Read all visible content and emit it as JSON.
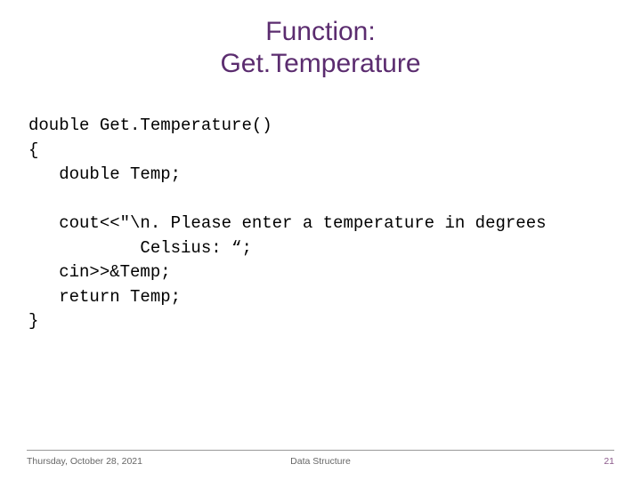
{
  "title_line1": "Function:",
  "title_line2": "Get.Temperature",
  "code": "double Get.Temperature()\n{\n   double Temp;\n\n   cout<<\"\\n. Please enter a temperature in degrees\n           Celsius: “;\n   cin>>&Temp;\n   return Temp;\n}",
  "footer": {
    "date": "Thursday, October 28, 2021",
    "center": "Data Structure",
    "page": "21"
  }
}
